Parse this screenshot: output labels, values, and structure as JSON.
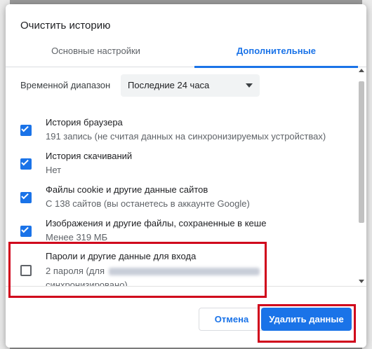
{
  "dialog": {
    "title": "Очистить историю"
  },
  "tabs": [
    {
      "label": "Основные настройки",
      "active": false
    },
    {
      "label": "Дополнительные",
      "active": true
    }
  ],
  "time_range": {
    "label": "Временной диапазон",
    "selected": "Последние 24 часа"
  },
  "items": [
    {
      "title": "История браузера",
      "subtitle": "191 запись (не считая данных на синхронизируемых устройствах)",
      "checked": true
    },
    {
      "title": "История скачиваний",
      "subtitle": "Нет",
      "checked": true
    },
    {
      "title": "Файлы cookie и другие данные сайтов",
      "subtitle": "С 138 сайтов (вы останетесь в аккаунте Google)",
      "checked": true
    },
    {
      "title": "Изображения и другие файлы, сохраненные в кеше",
      "subtitle": "Менее 319 МБ",
      "checked": true
    },
    {
      "title": "Пароли и другие данные для входа",
      "subtitle": "2 пароля (для",
      "subtitle_line2": "синхронизировано)",
      "checked": false
    }
  ],
  "buttons": {
    "cancel": "Отмена",
    "delete": "Удалить данные"
  },
  "colors": {
    "accent": "#1a73e8",
    "highlight": "#d0021b"
  }
}
